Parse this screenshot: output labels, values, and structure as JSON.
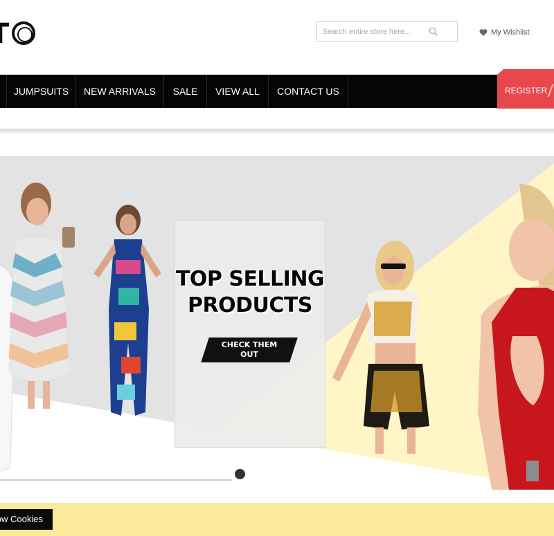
{
  "header": {
    "logo_text": "TO",
    "search": {
      "placeholder": "Search entire store here...",
      "icon": "search-icon"
    },
    "wishlist": {
      "label": "My Wishlist",
      "icon": "heart-icon"
    }
  },
  "nav": {
    "items": [
      {
        "label": "JUMPSUITS"
      },
      {
        "label": "NEW ARRIVALS"
      },
      {
        "label": "SALE"
      },
      {
        "label": "VIEW ALL"
      },
      {
        "label": "CONTACT US"
      }
    ],
    "register_label": "REGISTER",
    "accent_color": "#e8474c"
  },
  "banner": {
    "headline_line1": "TOP SELLING",
    "headline_line2": "PRODUCTS",
    "cta_line1": "CHECK THEM",
    "cta_line2": "OUT",
    "colors": {
      "background": "#e3e3e3",
      "yellow": "#fff5c7"
    }
  },
  "cookie_bar": {
    "button_label": "ow Cookies",
    "background": "#fde99a"
  }
}
